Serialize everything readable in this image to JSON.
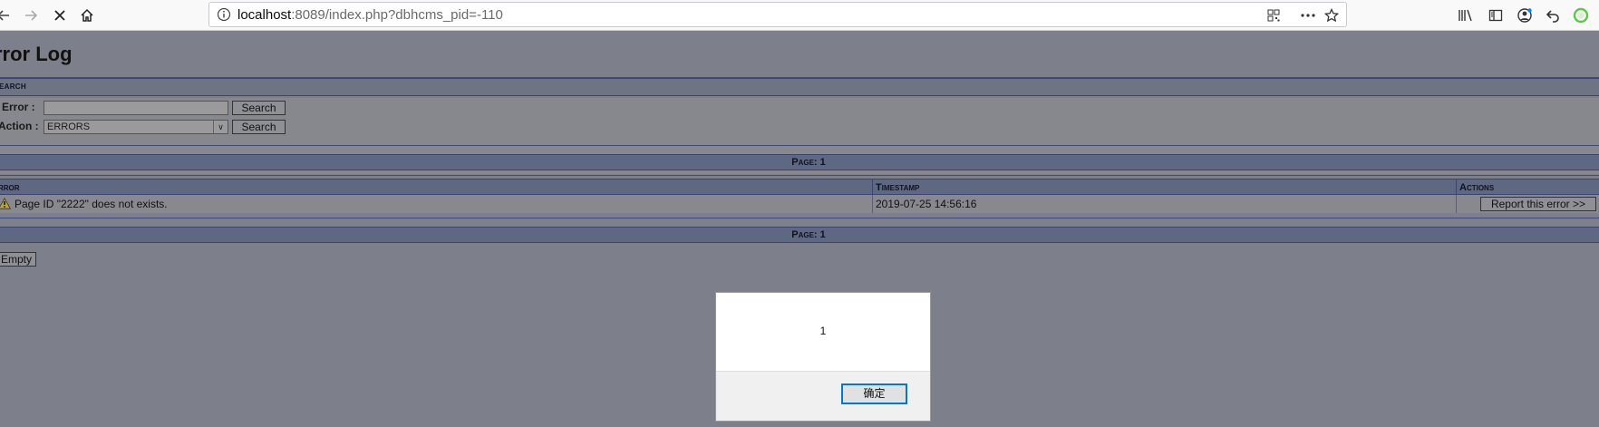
{
  "browser": {
    "url_host": "localhost",
    "url_rest": ":8089/index.php?dbhcms_pid=-110",
    "icons": [
      "back-icon",
      "forward-icon",
      "stop-icon",
      "home-icon",
      "page-info-icon",
      "qr-code-icon",
      "more-icon",
      "bookmark-star-icon",
      "library-icon",
      "sidebar-icon",
      "account-icon",
      "undo-icon",
      "extension-icon"
    ]
  },
  "page": {
    "title": "rror Log",
    "search_heading": "earch",
    "error_label": "Error :",
    "error_value": "",
    "action_label": "Action :",
    "action_selected": "ERRORS",
    "search_button_1": "Search",
    "search_button_2": "Search",
    "page_label_top": "Page: 1",
    "page_label_bottom": "Page: 1",
    "columns": {
      "error": "rror",
      "timestamp": "Timestamp",
      "actions": "Actions"
    },
    "rows": [
      {
        "error": "Page ID \"2222\" does not exists.",
        "timestamp": "2019-07-25 14:56:16",
        "action": "Report this error >>"
      }
    ],
    "empty_button": "Empty"
  },
  "dialog": {
    "message": "1",
    "ok_label": "确定"
  },
  "colors": {
    "overlay_bg": "#7d808b",
    "band": "#5f6882",
    "band_border": "#3b4570",
    "dialog_focus": "#0078d7"
  }
}
